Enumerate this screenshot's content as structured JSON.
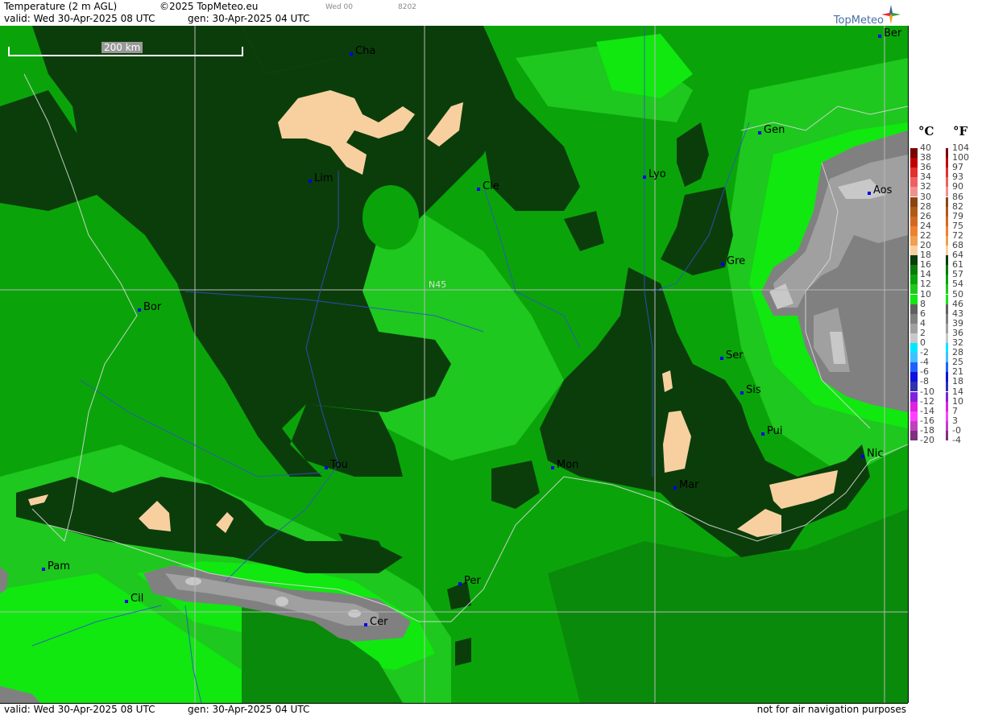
{
  "header": {
    "title": "Temperature (2 m AGL)",
    "copyright": "©2025 TopMeteo.eu",
    "valid": "valid:  Wed  30-Apr-2025  08 UTC",
    "gen": "gen: 30-Apr-2025 04 UTC",
    "run": "Wed 00",
    "code": "8202",
    "brand": "TopMeteo"
  },
  "map": {
    "scale_label": "200 km",
    "lat_label": "N45",
    "cities": [
      {
        "name": "Cha"
      },
      {
        "name": "Lim"
      },
      {
        "name": "Cle"
      },
      {
        "name": "Lyo"
      },
      {
        "name": "Gen"
      },
      {
        "name": "Ber"
      },
      {
        "name": "Aos"
      },
      {
        "name": "Gre"
      },
      {
        "name": "Bor"
      },
      {
        "name": "Ser"
      },
      {
        "name": "Sis"
      },
      {
        "name": "Pui"
      },
      {
        "name": "Tou"
      },
      {
        "name": "Mon"
      },
      {
        "name": "Mar"
      },
      {
        "name": "Nic"
      },
      {
        "name": "Pam"
      },
      {
        "name": "Cil"
      },
      {
        "name": "Per"
      },
      {
        "name": "Cer"
      }
    ]
  },
  "footer": {
    "valid": "valid:  Wed  30-Apr-2025  08 UTC",
    "gen": "gen: 30-Apr-2025 04 UTC",
    "notice": "not for air navigation purposes"
  },
  "legend": {
    "unit_c": "°C",
    "unit_f": "°F",
    "celsius": [
      "40",
      "38",
      "36",
      "34",
      "32",
      "30",
      "28",
      "26",
      "24",
      "22",
      "20",
      "18",
      "16",
      "14",
      "12",
      "10",
      "8",
      "6",
      "4",
      "2",
      "0",
      "-2",
      "-4",
      "-6",
      "-8",
      "-10",
      "-12",
      "-14",
      "-16",
      "-18",
      "-20"
    ],
    "fahrenheit": [
      "104",
      "100",
      "97",
      "93",
      "90",
      "86",
      "82",
      "79",
      "75",
      "72",
      "68",
      "64",
      "61",
      "57",
      "54",
      "50",
      "46",
      "43",
      "39",
      "36",
      "32",
      "28",
      "25",
      "21",
      "18",
      "14",
      "10",
      "7",
      "3",
      "-0",
      "-4"
    ],
    "colors": [
      "#7a0000",
      "#c00000",
      "#e03030",
      "#f06060",
      "#f09090",
      "#8b4513",
      "#b05a1a",
      "#d06a20",
      "#f08030",
      "#f0a050",
      "#f8d0a0",
      "#0b3d0b",
      "#0a7a0a",
      "#0aa40a",
      "#1ec81e",
      "#10e810",
      "#606060",
      "#808080",
      "#a0a0a0",
      "#c8c8c8",
      "#00e8ff",
      "#40c0ff",
      "#2060ff",
      "#1010e0",
      "#3030b0",
      "#8020e0",
      "#e020e0",
      "#ff40ff",
      "#c040c0",
      "#803080"
    ]
  }
}
